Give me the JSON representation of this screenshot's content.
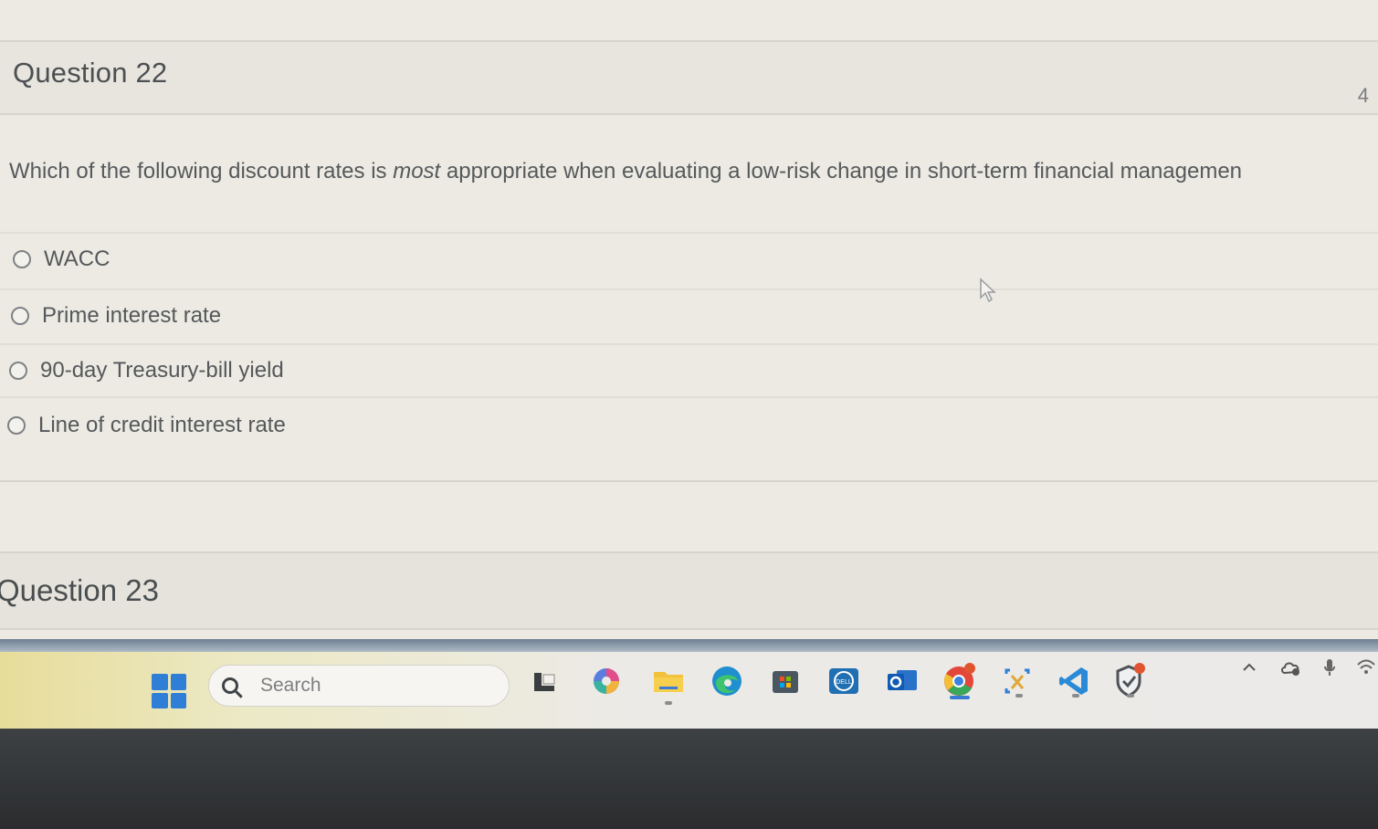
{
  "question": {
    "title": "Question 22",
    "points": "4",
    "text_before": "Which of the following discount rates is ",
    "text_emphasis": "most",
    "text_after": " appropriate when evaluating a low-risk change in short-term financial managemen",
    "answers": [
      {
        "label": "WACC"
      },
      {
        "label": "Prime interest rate"
      },
      {
        "label": "90-day Treasury-bill yield"
      },
      {
        "label": "Line of credit interest rate"
      }
    ]
  },
  "next_question": {
    "title": "Question 23"
  },
  "taskbar": {
    "search_placeholder": "Search",
    "icons": [
      {
        "name": "file-explorer-icon"
      },
      {
        "name": "copilot-icon"
      },
      {
        "name": "folder-icon"
      },
      {
        "name": "edge-icon"
      },
      {
        "name": "microsoft-store-icon"
      },
      {
        "name": "dell-icon"
      },
      {
        "name": "outlook-icon"
      },
      {
        "name": "chrome-icon"
      },
      {
        "name": "snipping-tool-icon"
      },
      {
        "name": "vscode-icon"
      },
      {
        "name": "security-shield-icon"
      }
    ],
    "tray": [
      {
        "name": "chevron-up-icon"
      },
      {
        "name": "cloud-sync-icon"
      },
      {
        "name": "microphone-icon"
      },
      {
        "name": "wifi-icon"
      }
    ]
  },
  "colors": {
    "accent_blue": "#2f7fd6",
    "badge_red": "#e0552f"
  }
}
